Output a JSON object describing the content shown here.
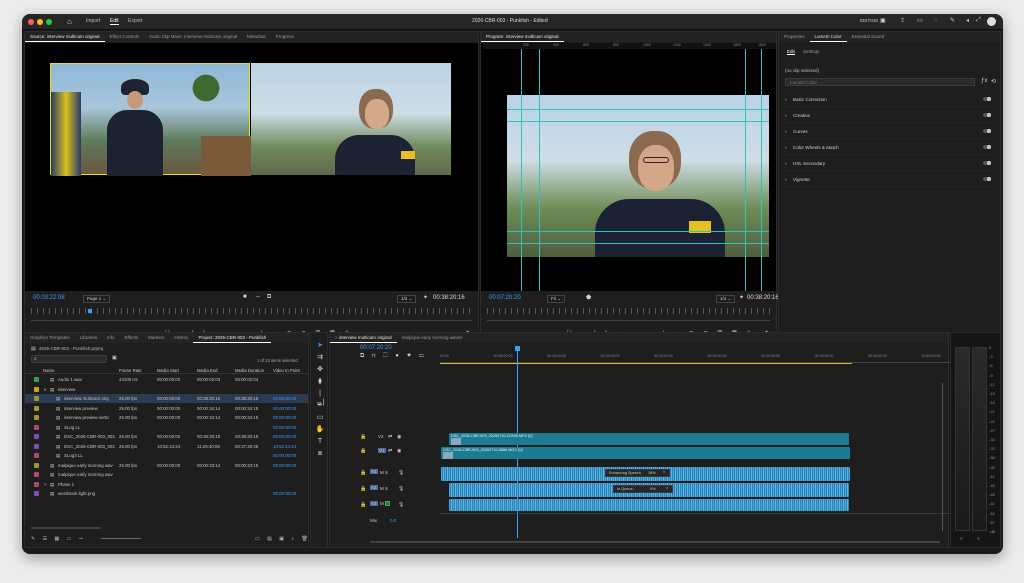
{
  "titlebar": {
    "title": "2026-CBR-003 - Punkfish",
    "status": "Edited",
    "menu": [
      "Import",
      "Edit",
      "Export"
    ],
    "workspace": "EDITING"
  },
  "source": {
    "tabs": [
      "Source: interview multicam original",
      "Effect Controls",
      "Audio Clip Mixer: interview multicam original",
      "Metadata",
      "Progress"
    ],
    "timecode": "00:03:22:08",
    "page": "Page 1",
    "zoom": "1/2",
    "duration": "00:38:20:16"
  },
  "program": {
    "tabs": [
      "Program: interview multicam original"
    ],
    "timecode": "00:07:20:20",
    "fit": "Fit",
    "zoom": "1/4",
    "duration": "00:38:20:16",
    "ruler": [
      "200",
      "400",
      "600",
      "800",
      "1000",
      "1200",
      "1400",
      "1600",
      "1800"
    ]
  },
  "lumetri": {
    "tabs": [
      "Properties",
      "Lumetri Color",
      "Essential Sound"
    ],
    "subtabs": [
      "Edit",
      "Settings"
    ],
    "clip_status": "(no clip selected)",
    "preset": "Lumetri Color",
    "sections": [
      "Basic Correction",
      "Creative",
      "Curves",
      "Color Wheels & Match",
      "HSL Secondary",
      "Vignette"
    ]
  },
  "project": {
    "tabs": [
      "Graphics Templates",
      "Libraries",
      "Info",
      "Effects",
      "Markers",
      "History",
      "Project: 2026-CBR-003 - Punkfish"
    ],
    "path": "2026-CBR-003 - Punkfish.prproj",
    "selection": "1 of 13 items selected",
    "columns": [
      "Name",
      "Frame Rate",
      "Media Start",
      "Media End",
      "Media Duration",
      "Video In Point"
    ],
    "items": [
      {
        "name": "Audio 1.wav",
        "fps": "44100 Hz",
        "start": "00:00:00:00",
        "end": "00:00:02:03",
        "dur": "00:00:02:04",
        "vin": "",
        "color": "#3f9e4a",
        "indent": 0,
        "chev": ""
      },
      {
        "name": "interview",
        "fps": "",
        "start": "",
        "end": "",
        "dur": "",
        "vin": "",
        "color": "#c9a227",
        "indent": 0,
        "chev": "v"
      },
      {
        "name": "interview multicam orig",
        "fps": "25.00 fps",
        "start": "00:00:00:00",
        "end": "00:38:20:15",
        "dur": "00:38:20:16",
        "vin": "00:00:00:00",
        "color": "#9a9a2a",
        "indent": 1,
        "chev": "",
        "selected": true
      },
      {
        "name": "interview preview",
        "fps": "25.00 fps",
        "start": "00:00:00:00",
        "end": "00:00:34:14",
        "dur": "00:00:34:15",
        "vin": "00:00:00:00",
        "color": "#9a9a2a",
        "indent": 1,
        "chev": ""
      },
      {
        "name": "interview preview vertic",
        "fps": "25.00 fps",
        "start": "00:00:00:00",
        "end": "00:00:34:14",
        "dur": "00:00:34:15",
        "vin": "00:00:00:00",
        "color": "#9a9a2a",
        "indent": 1,
        "chev": ""
      },
      {
        "name": "SLog LL",
        "fps": "",
        "start": "",
        "end": "",
        "dur": "",
        "vin": "00:00:00:00",
        "color": "#b3476b",
        "indent": 1,
        "chev": ""
      },
      {
        "name": "DSC_2026-CBR-003_002",
        "fps": "25.00 fps",
        "start": "00:00:00:00",
        "end": "00:38:20:15",
        "dur": "00:38:20:16",
        "vin": "00:00:00:00",
        "color": "#7b4fb8",
        "indent": 1,
        "chev": ""
      },
      {
        "name": "DSC_2026-CBR-003_002",
        "fps": "25.00 fps",
        "start": "10:52:14:24",
        "end": "11:29:40:09",
        "dur": "00:37:30:36",
        "vin": "10:52:14:24",
        "color": "#7b4fb8",
        "indent": 1,
        "chev": ""
      },
      {
        "name": "SLog3 LL",
        "fps": "",
        "start": "",
        "end": "",
        "dur": "",
        "vin": "00:00:00:00",
        "color": "#b3476b",
        "indent": 1,
        "chev": ""
      },
      {
        "name": "malpique early morning wav",
        "fps": "25.00 fps",
        "start": "00:00:00:00",
        "end": "00:00:23:14",
        "dur": "00:00:23:15",
        "vin": "00:00:00:00",
        "color": "#9a9a2a",
        "indent": 0,
        "chev": ""
      },
      {
        "name": "malpique early morning wav",
        "fps": "",
        "start": "",
        "end": "",
        "dur": "",
        "vin": "",
        "color": "#b3476b",
        "indent": 0,
        "chev": ""
      },
      {
        "name": "Phase 1",
        "fps": "",
        "start": "",
        "end": "",
        "dur": "",
        "vin": "",
        "color": "#b3476b",
        "indent": 0,
        "chev": ">"
      },
      {
        "name": "wordmark light.png",
        "fps": "",
        "start": "",
        "end": "",
        "dur": "",
        "vin": "00:00:00:00",
        "color": "#7b4fb8",
        "indent": 0,
        "chev": ""
      }
    ]
  },
  "timeline": {
    "tabs": [
      "interview multicam original",
      "malpique early morning waves"
    ],
    "timecode": "00:07:20:20",
    "ruler": [
      "00:00",
      "00:05:00:00",
      "00:10:00:00",
      "00:15:00:00",
      "00:20:00:00",
      "00:25:00:00",
      "00:30:00:00",
      "00:35:00:00",
      "00:40:00:00",
      "00:45:00:00"
    ],
    "tracks": [
      "V2",
      "V1",
      "A1",
      "A2",
      "A3"
    ],
    "mix_label": "Mix",
    "mix_value": "0.0",
    "clip_v2": "DSC_2026-CBR-003_20260710-C0949.MP4 [V]",
    "clip_v1": "DSC_2026-CBR-003_20260710-0650.MOV [V]",
    "job1": "Enhancing Speech",
    "job1_pct": "16%",
    "job2": "In Queue...",
    "job2_pct": "0%"
  },
  "meter": {
    "scale": [
      "0",
      "-3",
      "-6",
      "-9",
      "-12",
      "-15",
      "-18",
      "-21",
      "-24",
      "-27",
      "-30",
      "-33",
      "-36",
      "-39",
      "-42",
      "-45",
      "-48",
      "-51",
      "-54",
      "-57",
      "-dB"
    ],
    "channels": [
      "S",
      "S"
    ]
  }
}
